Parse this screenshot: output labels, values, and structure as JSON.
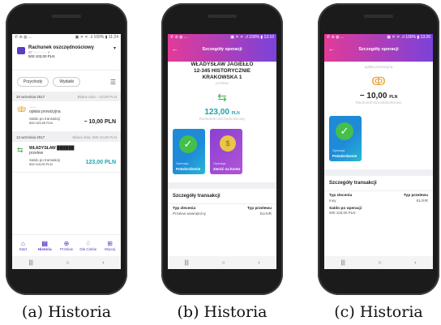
{
  "captions": [
    "(a) Historia",
    "(b) Historia",
    "(c) Historia"
  ],
  "screen_a": {
    "status_left": "✆ ⊘ ◍ ...",
    "status_right": "▣ ✕ ᯤ .ıl 100% ▮ 11:24",
    "account": {
      "name": "Rachunek oszczędnościowy",
      "number": "37 ··········· 2",
      "balance": "500 103,00 PLN"
    },
    "filters": {
      "income": "Przychody",
      "expenses": "Wydatki"
    },
    "groups": [
      {
        "date": "20 września 2017",
        "saldo": "Bilans dnia: −10,00 PLN",
        "items": [
          {
            "icon": "ↂ",
            "who": "───",
            "title": "opłata prowizyjna",
            "sub": "Saldo po transakcji",
            "subv": "500 103,00 PLN",
            "amount": "− 10,00 PLN",
            "positive": false
          }
        ]
      },
      {
        "date": "13 września 2017",
        "saldo": "Bilans dnia: 500 10,00 PLN",
        "items": [
          {
            "icon": "⇆",
            "who": "WŁADYSŁAW ██████",
            "title": "przelew",
            "sub": "Saldo po transakcji",
            "subv": "500 110,00 PLN",
            "amount": "123,00 PLN",
            "positive": true
          }
        ]
      }
    ],
    "tabs": [
      {
        "icon": "⌂",
        "label": "Start"
      },
      {
        "icon": "▤",
        "label": "Historia"
      },
      {
        "icon": "⊕",
        "label": "Przelew"
      },
      {
        "icon": "♢",
        "label": "Dla Ciebie"
      },
      {
        "icon": "⊞",
        "label": "Więcej"
      }
    ],
    "nav": [
      "|||",
      "○",
      "‹"
    ]
  },
  "screen_b": {
    "status_left": "✆ ⊘ ◍ ...",
    "status_right": "▣ ✕ ᯤ .ıl 100% ▮ 13:10",
    "title": "Szczegóły operacji",
    "address": [
      "WŁADYSŁAW JAGIEŁŁO",
      "12-345 HISTORYCZNIE",
      "KRAKOWSKA 1"
    ],
    "type": "przelew",
    "amount": "123,00",
    "currency": "PLN",
    "account": "Rachunek oszczędnościowy",
    "cards": [
      {
        "cap1": "Operacja",
        "cap2": "Potwierdzenie"
      },
      {
        "cap1": "Operacja",
        "cap2": "Zwróć na konto"
      }
    ],
    "details_title": "Szczegóły transakcji",
    "order_type_label": "Typ zlecenia",
    "order_type_value": "Przelew wewnętrzny",
    "transfer_type_label": "Typ przelewu",
    "transfer_type_value": "ELIXIR",
    "nav": [
      "|||",
      "○",
      "‹"
    ]
  },
  "screen_c": {
    "status_left": "✆ ⊘ ◍ ...",
    "status_right": "▣ ✕ ᯤ .ıl 100% ▮ 13:26",
    "title": "Szczegóły operacji",
    "type": "opłata prowizyjna",
    "amount": "− 10,00",
    "currency": "PLN",
    "account": "Rachunek oszczędnościowy",
    "card": {
      "cap1": "Operacja",
      "cap2": "Potwierdzenie"
    },
    "details_title": "Szczegóły transakcji",
    "order_type_label": "Typ zlecenia",
    "order_type_value": "Inny",
    "transfer_type_label": "Typ przelewu",
    "transfer_type_value": "ELIXIR",
    "balance_label": "Saldo po operacji",
    "balance_value": "500 103,00 PLN",
    "nav": [
      "|||",
      "○",
      "‹"
    ]
  }
}
